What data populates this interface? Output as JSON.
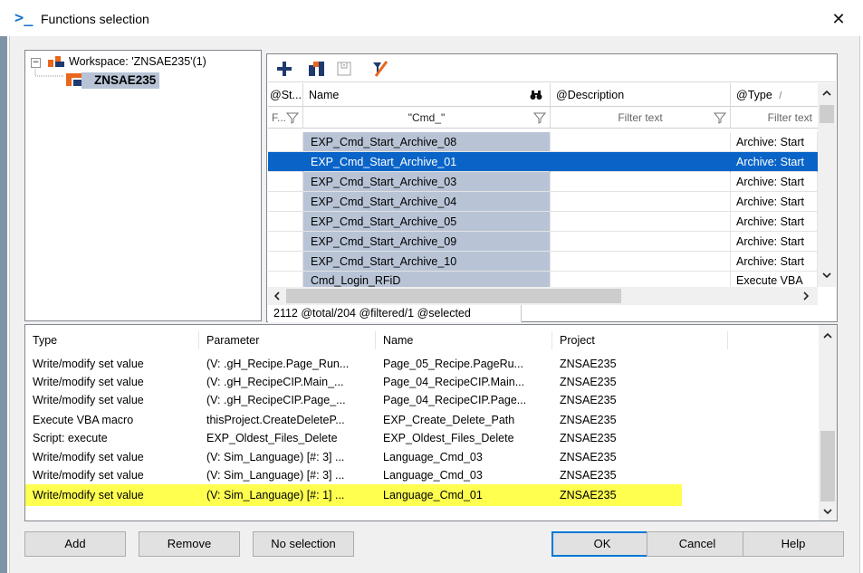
{
  "dialog": {
    "title": "Functions selection",
    "close_glyph": "✕",
    "title_icon": ">_"
  },
  "tree": {
    "workspace_label": "Workspace: 'ZNSAE235'(1)",
    "project_label": "ZNSAE235",
    "expander_glyph": "−"
  },
  "grid": {
    "headers": [
      "@St...",
      "Name",
      "@Description",
      "@Type"
    ],
    "filters": [
      "F...",
      "\"Cmd_\"",
      "Filter text",
      "Filter text"
    ],
    "rows": [
      {
        "name": "EXP_Cmd_Start_Archive_08",
        "description": "",
        "type": "Archive: Start"
      },
      {
        "name": "EXP_Cmd_Start_Archive_01",
        "description": "",
        "type": "Archive: Start",
        "selected": true
      },
      {
        "name": "EXP_Cmd_Start_Archive_03",
        "description": "",
        "type": "Archive: Start"
      },
      {
        "name": "EXP_Cmd_Start_Archive_04",
        "description": "",
        "type": "Archive: Start"
      },
      {
        "name": "EXP_Cmd_Start_Archive_05",
        "description": "",
        "type": "Archive: Start"
      },
      {
        "name": "EXP_Cmd_Start_Archive_09",
        "description": "",
        "type": "Archive: Start"
      },
      {
        "name": "EXP_Cmd_Start_Archive_10",
        "description": "",
        "type": "Archive: Start"
      },
      {
        "name": "Cmd_Login_RFiD",
        "description": "",
        "type": "Execute VBA"
      }
    ],
    "status": "2112 @total/204 @filtered/1 @selected"
  },
  "list": {
    "headers": [
      "Type",
      "Parameter",
      "Name",
      "Project"
    ],
    "rows": [
      {
        "type": "Write/modify set value",
        "parameter": "(V: .gH_Recipe.Page_Run...",
        "name": "Page_05_Recipe.PageRu...",
        "project": "ZNSAE235"
      },
      {
        "type": "Write/modify set value",
        "parameter": "(V: .gH_RecipeCIP.Main_...",
        "name": "Page_04_RecipeCIP.Main...",
        "project": "ZNSAE235"
      },
      {
        "type": "Write/modify set value",
        "parameter": "(V: .gH_RecipeCIP.Page_...",
        "name": "Page_04_RecipeCIP.Page...",
        "project": "ZNSAE235"
      },
      {
        "type": "Execute VBA macro",
        "parameter": "thisProject.CreateDeleteP...",
        "name": "EXP_Create_Delete_Path",
        "project": "ZNSAE235"
      },
      {
        "type": "Script: execute",
        "parameter": "EXP_Oldest_Files_Delete",
        "name": "EXP_Oldest_Files_Delete",
        "project": "ZNSAE235"
      },
      {
        "type": "Write/modify set value",
        "parameter": "(V: Sim_Language) [#: 3] ...",
        "name": "Language_Cmd_03",
        "project": "ZNSAE235"
      },
      {
        "type": "Write/modify set value",
        "parameter": "(V: Sim_Language) [#: 3] ...",
        "name": "Language_Cmd_03",
        "project": "ZNSAE235"
      },
      {
        "type": "Write/modify set value",
        "parameter": "(V: Sim_Language) [#: 1] ...",
        "name": "Language_Cmd_01",
        "project": "ZNSAE235",
        "highlighted": true
      }
    ]
  },
  "buttons": {
    "add": "Add",
    "remove": "Remove",
    "no_selection": "No selection",
    "ok": "OK",
    "cancel": "Cancel",
    "help": "Help"
  },
  "colors": {
    "selection": "#0a64c8",
    "name_column": "#b8c4d6",
    "highlight": "#ffff50",
    "accent": "#1a73c9"
  }
}
